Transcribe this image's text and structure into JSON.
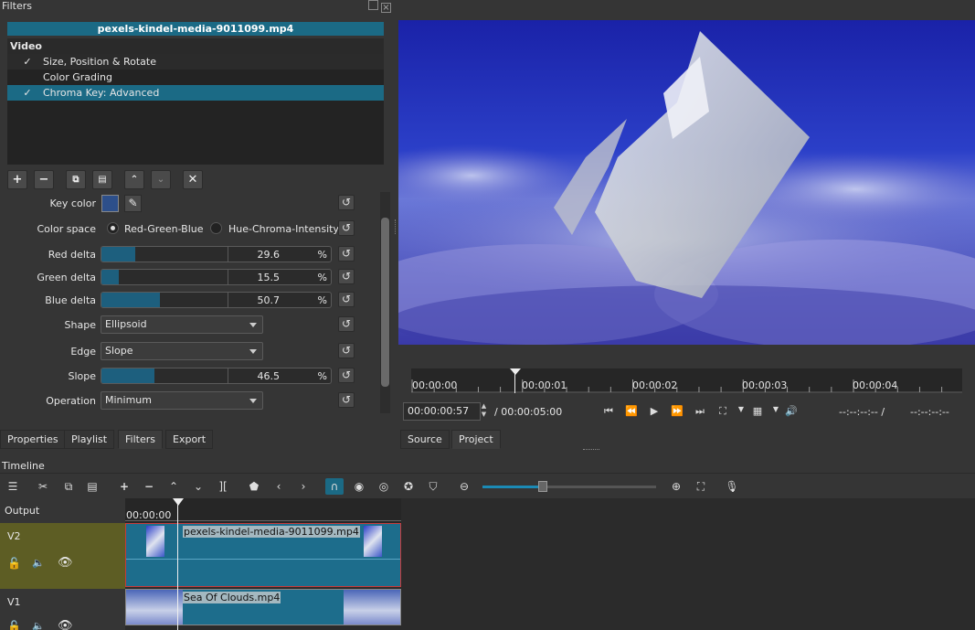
{
  "filters_panel": {
    "title": "Filters",
    "clip_name": "pexels-kindel-media-9011099.mp4",
    "group": "Video",
    "filters": [
      {
        "label": "Size, Position & Rotate",
        "checked": "✓"
      },
      {
        "label": "Color Grading",
        "checked": ""
      },
      {
        "label": "Chroma Key: Advanced",
        "checked": "✓"
      }
    ],
    "params": {
      "key_color_label": "Key color",
      "key_color": "#2d4f8a",
      "color_space_label": "Color space",
      "color_space_options": [
        "Red-Green-Blue",
        "Hue-Chroma-Intensity"
      ],
      "color_space_selected": "Red-Green-Blue",
      "red_delta": {
        "label": "Red delta",
        "value": "29.6",
        "unit": "%",
        "fraction": 0.296
      },
      "green_delta": {
        "label": "Green delta",
        "value": "15.5",
        "unit": "%",
        "fraction": 0.155
      },
      "blue_delta": {
        "label": "Blue delta",
        "value": "50.7",
        "unit": "%",
        "fraction": 0.507
      },
      "shape": {
        "label": "Shape",
        "value": "Ellipsoid"
      },
      "edge": {
        "label": "Edge",
        "value": "Slope"
      },
      "slope": {
        "label": "Slope",
        "value": "46.5",
        "unit": "%",
        "fraction": 0.465
      },
      "operation": {
        "label": "Operation",
        "value": "Minimum"
      }
    }
  },
  "left_tabs": [
    "Properties",
    "Playlist",
    "Filters",
    "Export"
  ],
  "left_tabs_active": "Filters",
  "viewer": {
    "ruler_labels": [
      "00:00:00",
      "00:00:01",
      "00:00:02",
      "00:00:03",
      "00:00:04"
    ],
    "current_time": "00:00:00:57",
    "duration": "/ 00:00:05:00",
    "in_point": "--:--:--:-- /",
    "out_point": "--:--:--:--",
    "tabs": [
      "Source",
      "Project"
    ],
    "active_tab": "Project"
  },
  "timeline": {
    "title": "Timeline",
    "output_label": "Output",
    "timecode": "00:00:00",
    "tracks": [
      {
        "name": "V2",
        "clip": "pexels-kindel-media-9011099.mp4"
      },
      {
        "name": "V1",
        "clip": "Sea Of Clouds.mp4"
      }
    ]
  },
  "colors": {
    "accent": "#1b6a85",
    "v2_head": "#5d5d24",
    "clip_blue": "#1d6d8c",
    "sky": "#1e33b8"
  }
}
